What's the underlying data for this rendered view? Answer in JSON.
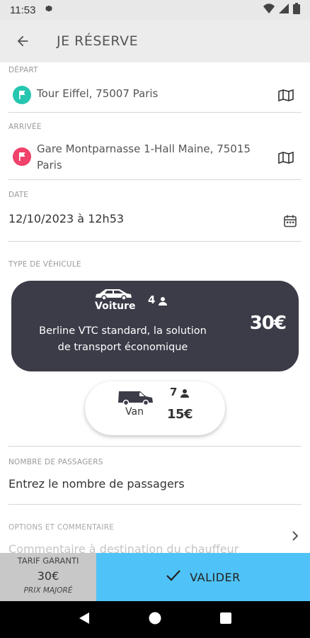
{
  "status": {
    "time": "11:53"
  },
  "header": {
    "title": "JE RÉSERVE"
  },
  "depart": {
    "label": "DÉPART",
    "value": "Tour Eiffel, 75007 Paris"
  },
  "arrivee": {
    "label": "ARRIVÉE",
    "value_line1": "Gare Montparnasse 1-Hall Maine, 75015",
    "value_line2": "Paris"
  },
  "date": {
    "label": "DATE",
    "value": "12/10/2023 à 12h53"
  },
  "vehicle": {
    "label": "TYPE DE VÉHICULE",
    "voiture": {
      "name": "Voiture",
      "capacity": "4",
      "desc_line1": "Berline VTC standard, la solution",
      "desc_line2": "de transport économique",
      "price": "30€"
    },
    "van": {
      "name": "Van",
      "capacity": "7",
      "price": "15€"
    }
  },
  "passengers": {
    "label": "NOMBRE DE PASSAGERS",
    "placeholder": "Entrez le nombre de passagers"
  },
  "options": {
    "label": "OPTIONS ET COMMENTAIRE",
    "placeholder": "Commentaire à destination du chauffeur"
  },
  "footer": {
    "tarif_label": "TARIF GARANTI",
    "tarif_value": "30€",
    "tarif_note": "PRIX MAJORÉ",
    "validate_label": "VALIDER"
  },
  "colors": {
    "accent": "#4fc3f7",
    "card_dark": "#3b3c48",
    "depart_pin": "#26c6b0",
    "arrivee_pin": "#f0426a"
  },
  "icons": [
    "settings-icon",
    "wifi-icon",
    "signal-icon",
    "battery-icon",
    "back-arrow-icon",
    "flag-icon",
    "map-icon",
    "calendar-icon",
    "car-icon",
    "van-icon",
    "person-icon",
    "chevron-right-icon",
    "check-icon",
    "nav-back-icon",
    "nav-home-icon",
    "nav-recents-icon"
  ]
}
